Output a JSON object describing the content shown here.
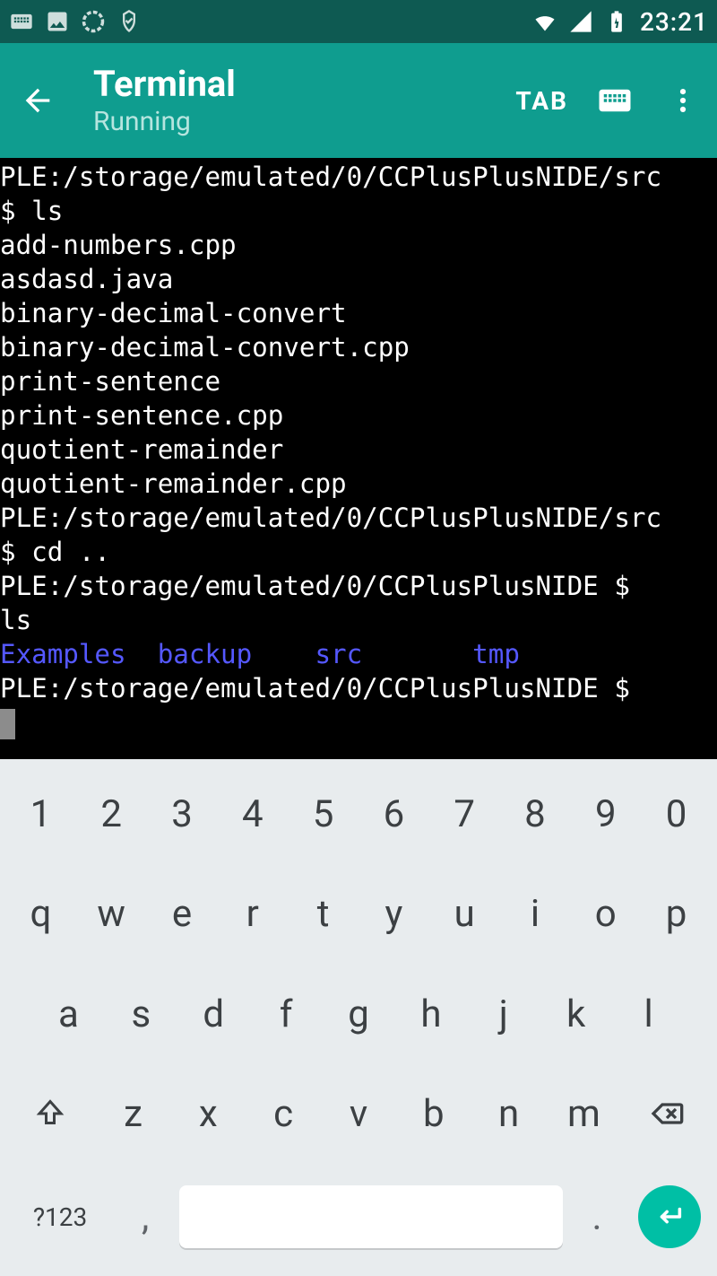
{
  "status_bar": {
    "clock": "23:21"
  },
  "app_bar": {
    "title": "Terminal",
    "subtitle": "Running",
    "tab_label": "TAB"
  },
  "terminal": {
    "prompt1": "PLE:/storage/emulated/0/CCPlusPlusNIDE/src",
    "cmd1": "$ ls",
    "out": [
      "add-numbers.cpp",
      "asdasd.java",
      "binary-decimal-convert",
      "binary-decimal-convert.cpp",
      "print-sentence",
      "print-sentence.cpp",
      "quotient-remainder",
      "quotient-remainder.cpp"
    ],
    "prompt2": "PLE:/storage/emulated/0/CCPlusPlusNIDE/src",
    "cmd2": "$ cd ..",
    "prompt3": "PLE:/storage/emulated/0/CCPlusPlusNIDE $ ",
    "cmd3": "ls",
    "dirs": "Examples  backup    src       tmp",
    "prompt4": "PLE:/storage/emulated/0/CCPlusPlusNIDE $ "
  },
  "keyboard": {
    "row1": [
      "1",
      "2",
      "3",
      "4",
      "5",
      "6",
      "7",
      "8",
      "9",
      "0"
    ],
    "row2": [
      "q",
      "w",
      "e",
      "r",
      "t",
      "y",
      "u",
      "i",
      "o",
      "p"
    ],
    "row3": [
      "a",
      "s",
      "d",
      "f",
      "g",
      "h",
      "j",
      "k",
      "l"
    ],
    "row4": [
      "z",
      "x",
      "c",
      "v",
      "b",
      "n",
      "m"
    ],
    "symbol_key": "?123",
    "comma": ",",
    "period": "."
  }
}
